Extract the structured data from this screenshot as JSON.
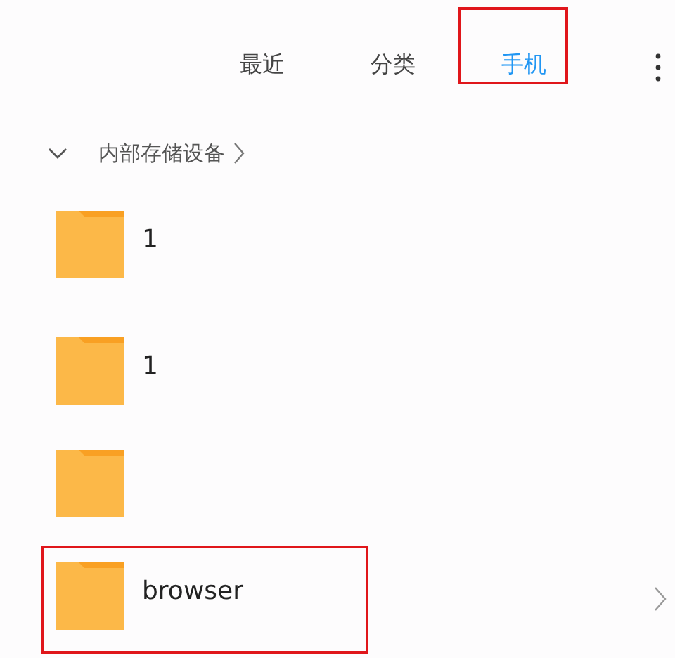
{
  "tabs": [
    {
      "label": "最近",
      "selected": false,
      "highlighted": false
    },
    {
      "label": "分类",
      "selected": false,
      "highlighted": false
    },
    {
      "label": "手机",
      "selected": true,
      "highlighted": true
    }
  ],
  "breadcrumb": {
    "expanded": true,
    "label": "内部存储设备"
  },
  "folders": [
    {
      "name": "1",
      "highlighted": false,
      "chevron": false
    },
    {
      "name": "1",
      "highlighted": false,
      "chevron": false
    },
    {
      "highlighted": false,
      "chevron": false
    },
    {
      "name": "browser",
      "highlighted": true,
      "chevron": true
    }
  ]
}
